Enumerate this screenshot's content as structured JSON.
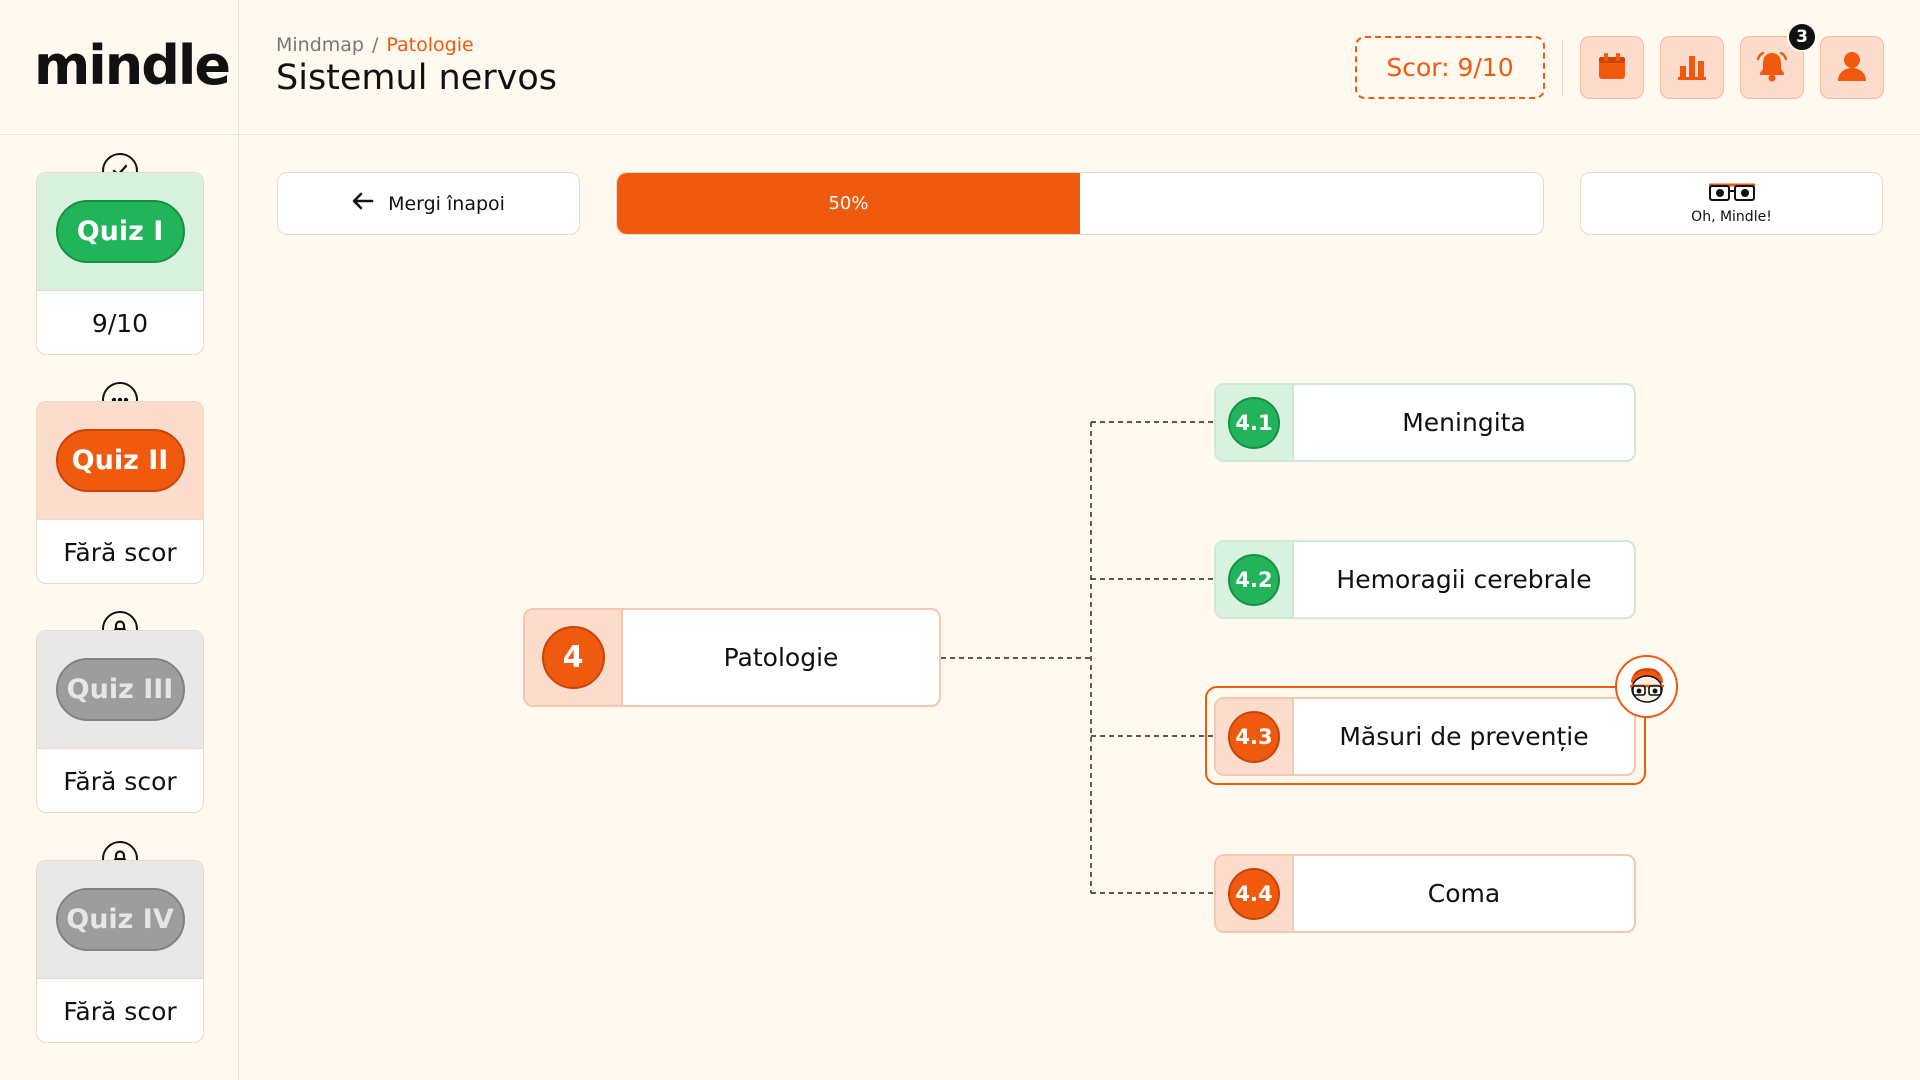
{
  "brand": {
    "logo": "mindle",
    "accent": "#f05a0e",
    "success": "#22b45a"
  },
  "header": {
    "breadcrumb": [
      "Mindmap",
      "Patologie"
    ],
    "breadcrumb_separator": "/",
    "title": "Sistemul nervos",
    "score_label": "Scor: 9/10",
    "icons": [
      "calendar-icon",
      "bar-chart-icon",
      "bell-icon",
      "user-icon"
    ],
    "notification_count": "3"
  },
  "sidebar": {
    "quizzes": [
      {
        "label": "Quiz I",
        "score": "9/10",
        "status": "completed",
        "status_icon": "check-circle-icon"
      },
      {
        "label": "Quiz II",
        "score": "Fără scor",
        "status": "in-progress",
        "status_icon": "more-dots-icon"
      },
      {
        "label": "Quiz III",
        "score": "Fără scor",
        "status": "locked",
        "status_icon": "lock-icon"
      },
      {
        "label": "Quiz IV",
        "score": "Fără scor",
        "status": "locked",
        "status_icon": "lock-icon"
      }
    ]
  },
  "toolbar": {
    "back_label": "Mergi înapoi",
    "progress_percent": 50,
    "progress_label": "50%",
    "mindle_label": "Oh, Mindle!"
  },
  "mindmap": {
    "root": {
      "number": "4",
      "label": "Patologie"
    },
    "children": [
      {
        "number": "4.1",
        "label": "Meningita",
        "status": "completed"
      },
      {
        "number": "4.2",
        "label": "Hemoragii cerebrale",
        "status": "completed"
      },
      {
        "number": "4.3",
        "label": "Măsuri de prevenție",
        "status": "current"
      },
      {
        "number": "4.4",
        "label": "Coma",
        "status": "pending"
      }
    ]
  }
}
